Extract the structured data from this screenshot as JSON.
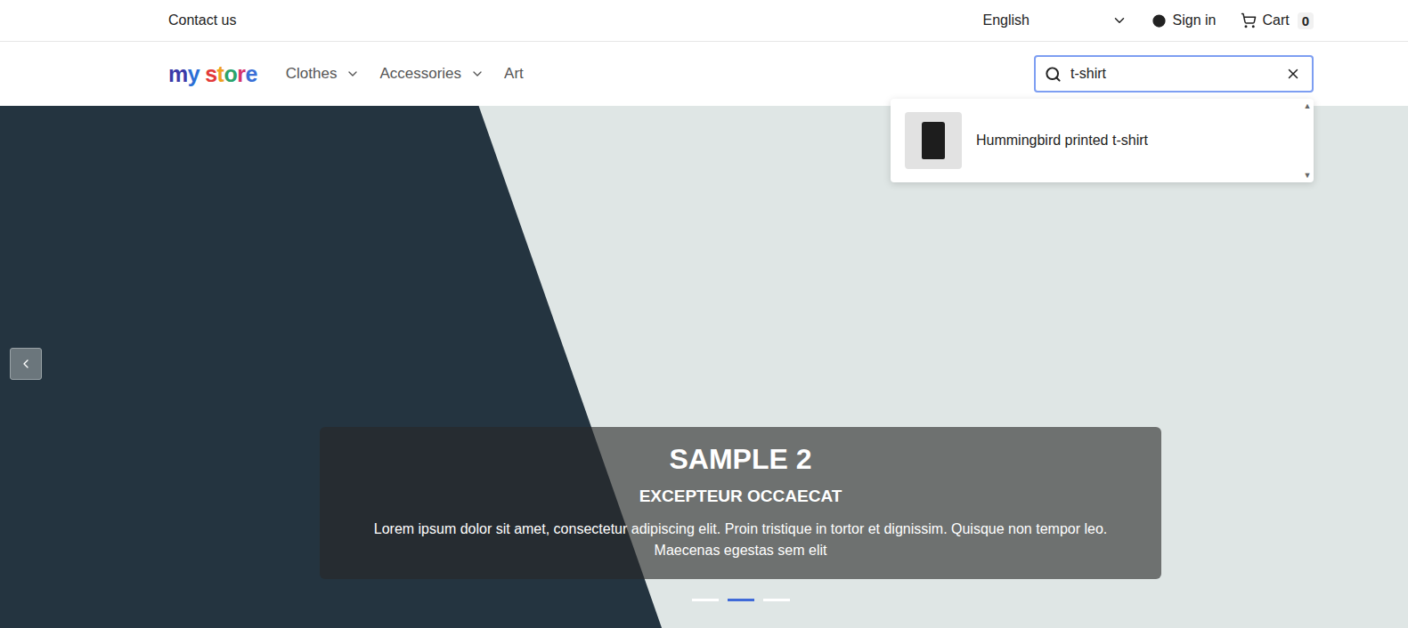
{
  "topbar": {
    "contact": "Contact us",
    "language": "English",
    "sign_in": "Sign in",
    "cart": {
      "label": "Cart",
      "count": "0"
    }
  },
  "header": {
    "logo": {
      "first": "my",
      "second": "store"
    },
    "nav": [
      {
        "label": "Clothes",
        "has_menu": true
      },
      {
        "label": "Accessories",
        "has_menu": true
      },
      {
        "label": "Art",
        "has_menu": false
      }
    ]
  },
  "search": {
    "value": "t-shirt",
    "results": [
      {
        "name": "Hummingbird printed t-shirt"
      }
    ]
  },
  "hero": {
    "title": "SAMPLE 2",
    "subtitle": "EXCEPTEUR OCCAECAT",
    "text": "Lorem ipsum dolor sit amet, consectetur adipiscing elit. Proin tristique in tortor et dignissim. Quisque non tempor leo. Maecenas egestas sem elit",
    "slides": [
      {
        "selected": false
      },
      {
        "selected": true
      },
      {
        "selected": false
      }
    ]
  }
}
